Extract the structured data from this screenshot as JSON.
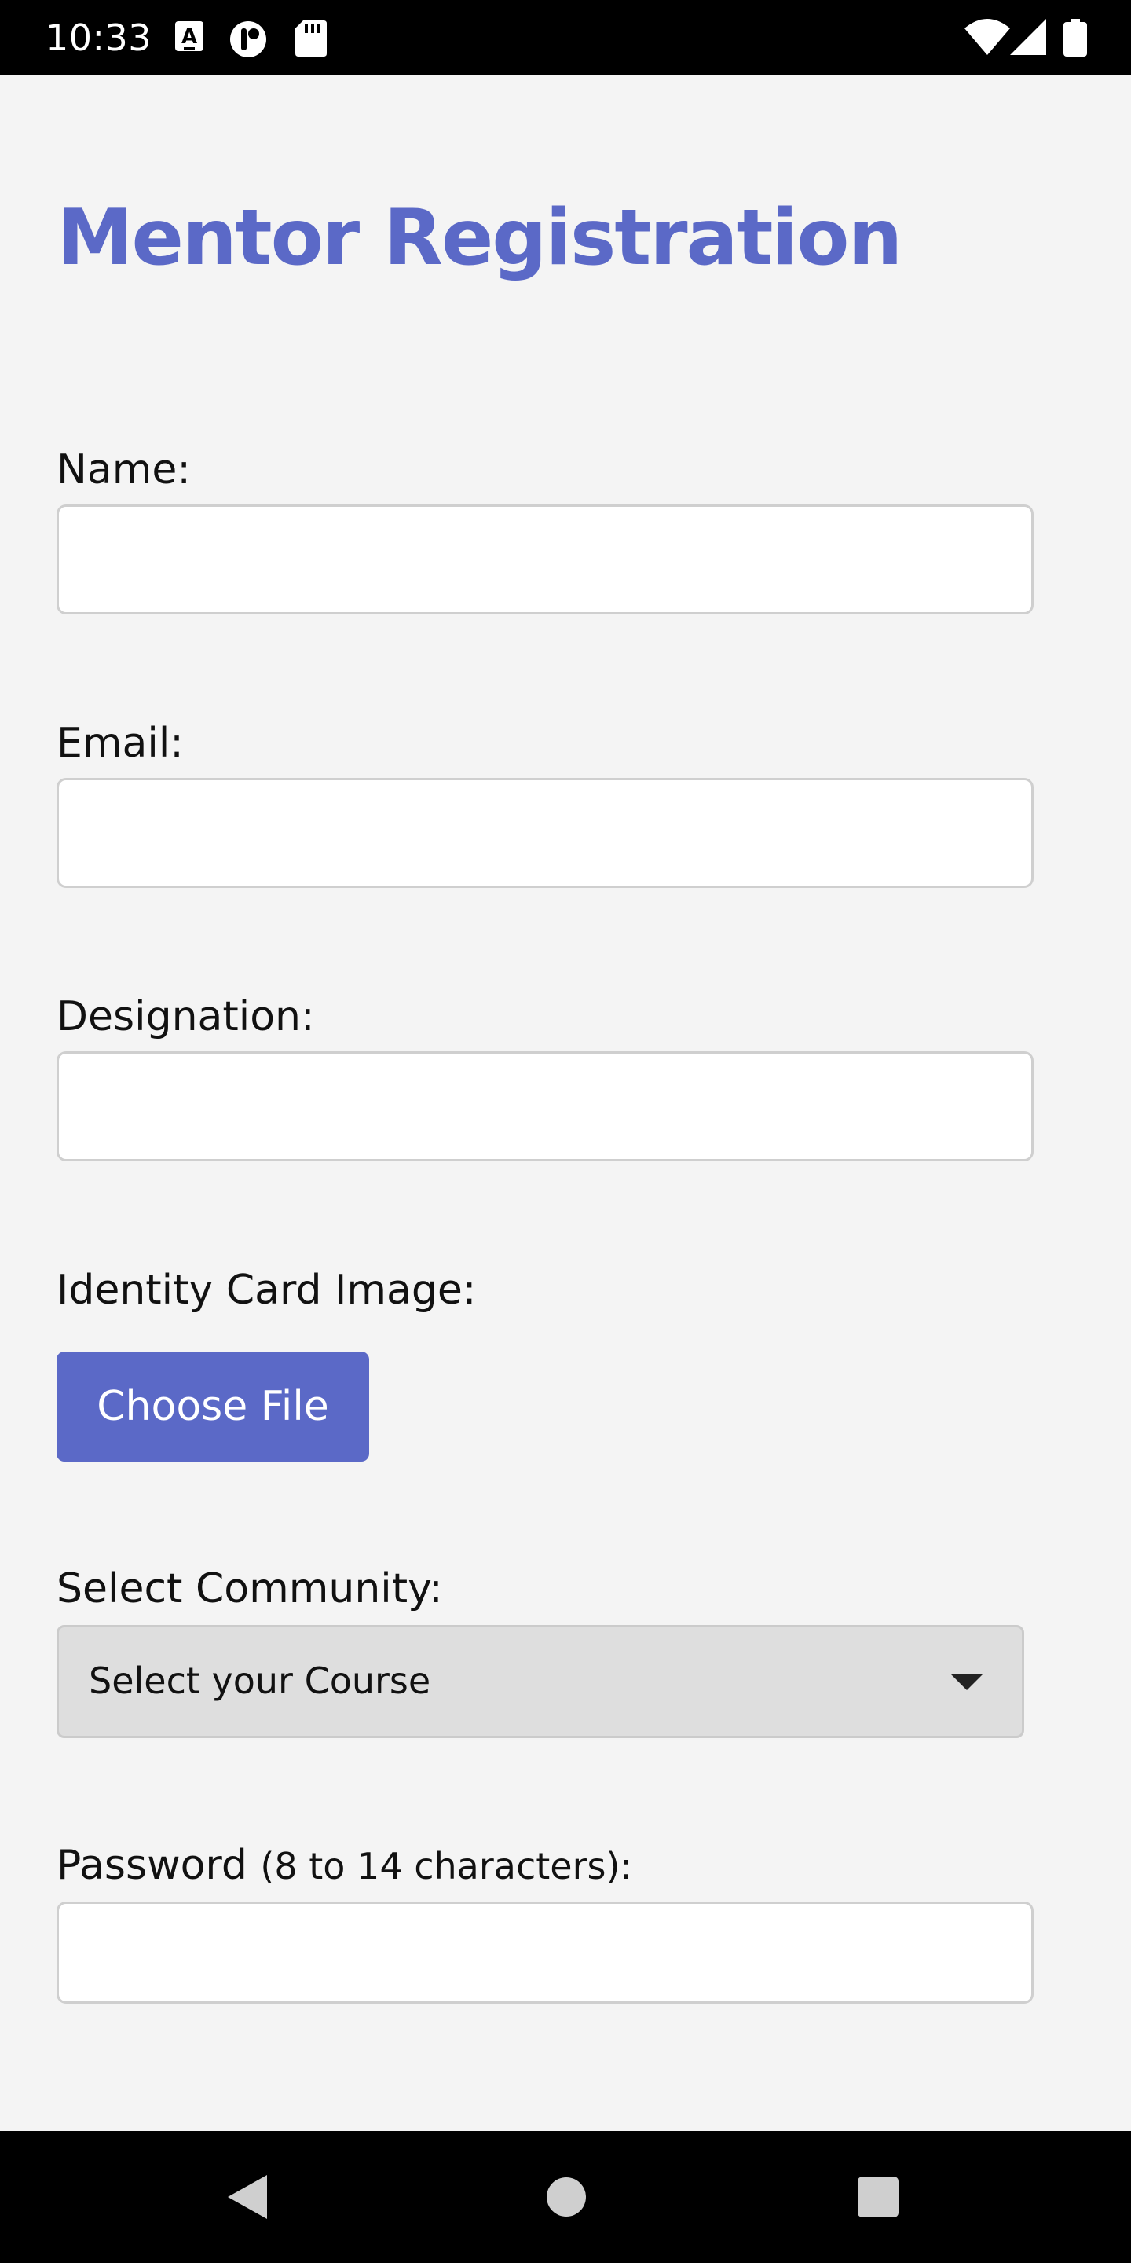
{
  "status_bar": {
    "time": "10:33",
    "left_icons": [
      "keyboard-a-icon",
      "face-toggle-icon",
      "sd-card-icon"
    ],
    "right_icons": [
      "wifi-icon",
      "signal-icon",
      "battery-icon"
    ]
  },
  "page": {
    "title": "Mentor Registration",
    "accent_color": "#5b69c7"
  },
  "form": {
    "name_label": "Name:",
    "name_value": "",
    "email_label": "Email:",
    "email_value": "",
    "designation_label": "Designation:",
    "designation_value": "",
    "id_card_label": "Identity Card Image:",
    "choose_file_label": "Choose File",
    "community_label": "Select Community:",
    "community_selected": "Select your Course",
    "password_label": "Password",
    "password_hint": "(8 to 14 characters):",
    "password_value": ""
  },
  "nav_bar": {
    "icons": [
      "back-icon",
      "home-icon",
      "recents-icon"
    ]
  }
}
